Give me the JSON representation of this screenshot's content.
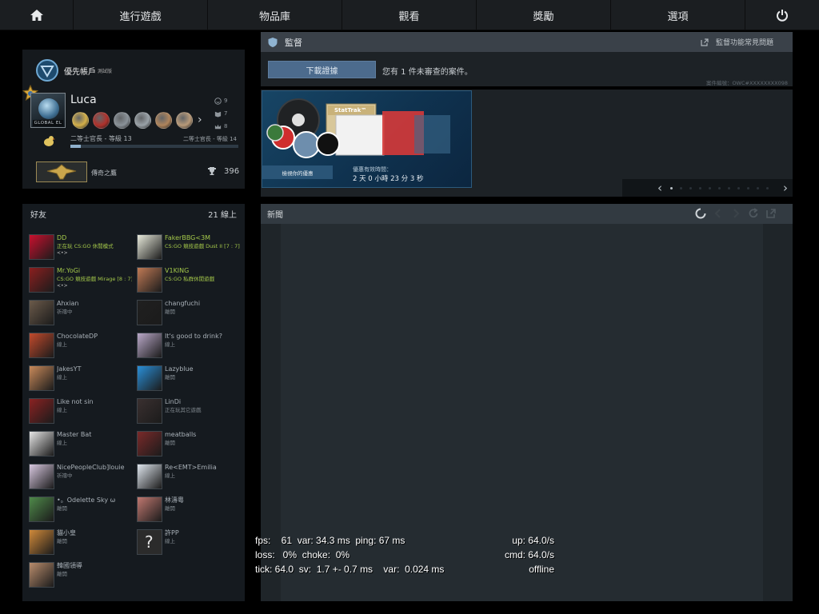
{
  "nav": {
    "home_icon": "home-icon",
    "tabs": [
      "進行遊戲",
      "物品庫",
      "觀看",
      "獎勵",
      "選項"
    ],
    "power_icon": "power-icon"
  },
  "profile": {
    "prime_label": "優先帳戶",
    "prime_sub": "測試版",
    "name": "Luca",
    "rank_badge": "GLOBAL EL",
    "rank_current": "二等士官長 - 等級 13",
    "rank_next": "二等士官長 - 等級 14",
    "rank_progress": 0.06,
    "counts": [
      "9",
      "7",
      "8"
    ],
    "badge_colors": [
      "#d4b04a",
      "#b0312b",
      "#8a9299",
      "#9aa2a8",
      "#b0855c",
      "#b89a79"
    ],
    "medal_name": "傳奇之鷹",
    "trophy_count": "396"
  },
  "friends": {
    "title": "好友",
    "online": "21 線上",
    "list": [
      {
        "name": "DD",
        "status": "正在玩 CS:GO 休閒模式",
        "extra": "<•>",
        "ingame": true,
        "color": "#c8102e"
      },
      {
        "name": "FakerBBG<3M",
        "status": "CS:GO 競技遊戲 Dust II [7 : 7]",
        "extra": "",
        "ingame": true,
        "color": "#e8eadb"
      },
      {
        "name": "Mr.YoGi",
        "status": "CS:GO 競技遊戲 Mirage [8 : 7]",
        "extra": "<•>",
        "ingame": true,
        "color": "#8b1f1f"
      },
      {
        "name": "V1KING",
        "status": "CS:GO 私群休閒遊戲",
        "extra": "",
        "ingame": true,
        "color": "#c07a55"
      },
      {
        "name": "Ahxian",
        "status": "祈禱中",
        "extra": "",
        "ingame": false,
        "color": "#6b5a4a"
      },
      {
        "name": "changfuchi",
        "status": "離開",
        "extra": "",
        "ingame": false,
        "color": "#202020"
      },
      {
        "name": "ChocolateDP",
        "status": "線上",
        "extra": "",
        "ingame": false,
        "color": "#c24a2c"
      },
      {
        "name": "It's good to drink?",
        "status": "線上",
        "extra": "",
        "ingame": false,
        "color": "#b9a8c8"
      },
      {
        "name": "JakesYT",
        "status": "線上",
        "extra": "",
        "ingame": false,
        "color": "#c98a5a"
      },
      {
        "name": "Lazyblue",
        "status": "離開",
        "extra": "",
        "ingame": false,
        "color": "#2a8fd8"
      },
      {
        "name": "Like not sin",
        "status": "線上",
        "extra": "",
        "ingame": false,
        "color": "#8a2222"
      },
      {
        "name": "LinDi",
        "status": "正在玩其它遊戲",
        "extra": "",
        "ingame": false,
        "color": "#3a3030"
      },
      {
        "name": "Master Bat",
        "status": "線上",
        "extra": "",
        "ingame": false,
        "color": "#e6e6e6"
      },
      {
        "name": "meatballs",
        "status": "離開",
        "extra": "",
        "ingame": false,
        "color": "#7a2a2a"
      },
      {
        "name": "NicePeopleClub]louie",
        "status": "祈禱中",
        "extra": "",
        "ingame": false,
        "color": "#d8c8e0"
      },
      {
        "name": "Re<EMT>Emilia",
        "status": "線上",
        "extra": "",
        "ingame": false,
        "color": "#dfe6ee"
      },
      {
        "name": "•。Odelette Sky ω",
        "status": "離開",
        "extra": "",
        "ingame": false,
        "color": "#4f8a4a"
      },
      {
        "name": "林濤粵",
        "status": "離開",
        "extra": "",
        "ingame": false,
        "color": "#c07870"
      },
      {
        "name": "貓小皇",
        "status": "離開",
        "extra": "",
        "ingame": false,
        "color": "#d08a3a"
      },
      {
        "name": "許PP",
        "status": "線上",
        "extra": "",
        "ingame": false,
        "color": "#2b2b2b"
      },
      {
        "name": "韓國領導",
        "status": "離開",
        "extra": "",
        "ingame": false,
        "color": "#b88c6c"
      }
    ]
  },
  "overwatch": {
    "title": "監督",
    "faq": "監督功能常見問題",
    "download_button": "下載證據",
    "message": "您有 1 件未審查的案件。",
    "case_id": "案件編號：OWC#XXXXXXXX098"
  },
  "store": {
    "caption": "檢視你的優惠",
    "time_label": "優惠有效時間：",
    "time_left": "2 天 0 小時 23 分 3 秒",
    "stattrak": "StatTrak™",
    "dots": 11,
    "active_dot": 0
  },
  "news": {
    "title": "新聞"
  },
  "netgraph": {
    "line1": "fps:    61  var: 34.3 ms  ping: 67 ms",
    "line1_right": "up: 64.0/s",
    "line2": "loss:   0%  choke:  0%",
    "line2_right": "cmd: 64.0/s",
    "line3": "tick: 64.0  sv:  1.7 +- 0.7 ms    var:  0.024 ms",
    "line3_right": "offline"
  }
}
